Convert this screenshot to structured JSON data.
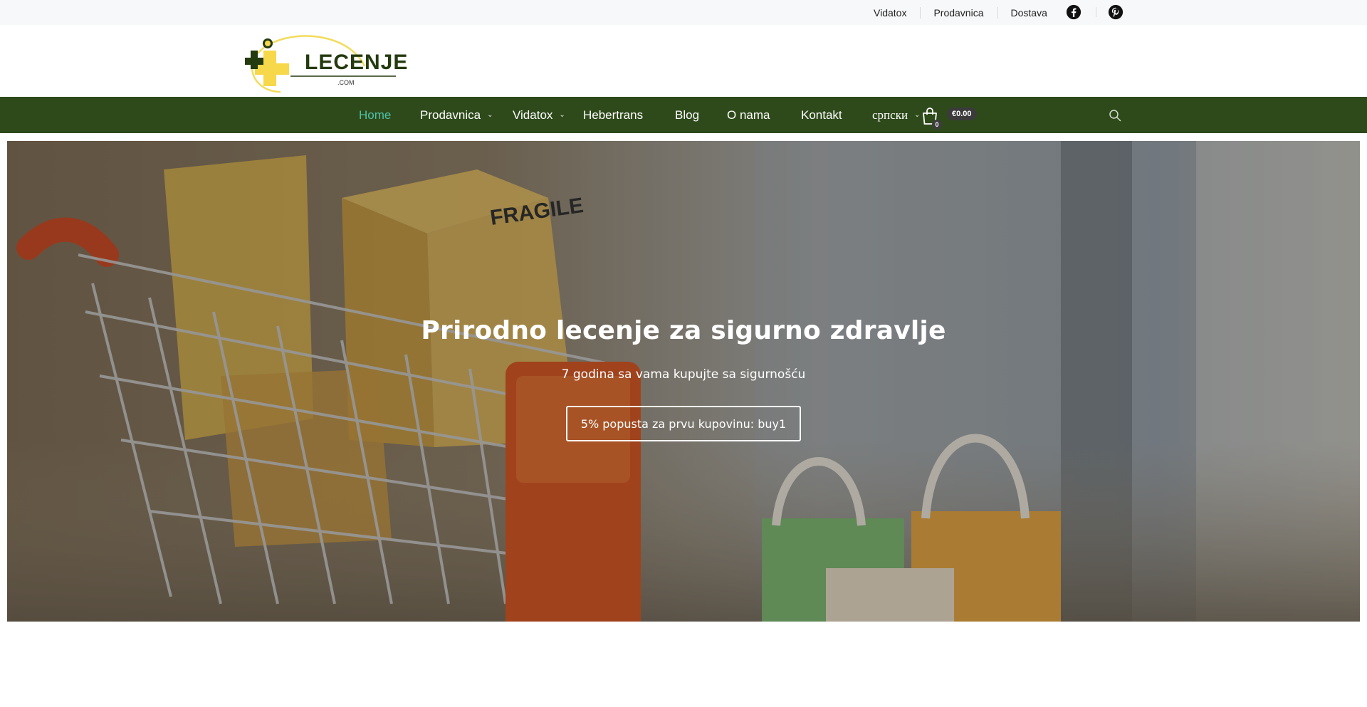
{
  "topbar": {
    "links": [
      "Vidatox",
      "Prodavnica",
      "Dostava"
    ],
    "social_icons": [
      "facebook-icon",
      "pinterest-icon"
    ]
  },
  "logo": {
    "word": "LECENJE",
    "suffix": ".COM"
  },
  "nav": {
    "items": [
      {
        "label": "Home",
        "active": true
      },
      {
        "label": "Prodavnica",
        "has_dropdown": true
      },
      {
        "label": "Vidatox",
        "has_dropdown": true
      },
      {
        "label": "Hebertrans"
      },
      {
        "label": "Blog"
      },
      {
        "label": "O nama"
      },
      {
        "label": "Kontakt"
      }
    ],
    "language": "српски",
    "cart_count": "0",
    "cart_total": "€0.00",
    "caret": "⌄"
  },
  "hero": {
    "title": "Prirodno lecenje za sigurno zdravlje",
    "subtitle": "7 godina sa vama kupujte sa sigurnošću",
    "button": "5% popusta za prvu kupovinu: buy1"
  },
  "colors": {
    "nav_bg": "#2e4a1b",
    "nav_active": "#4fc1a6",
    "topbar_bg": "#f7f8fa",
    "logo_text": "#243a0f",
    "logo_yellow": "#f2dc5d"
  }
}
